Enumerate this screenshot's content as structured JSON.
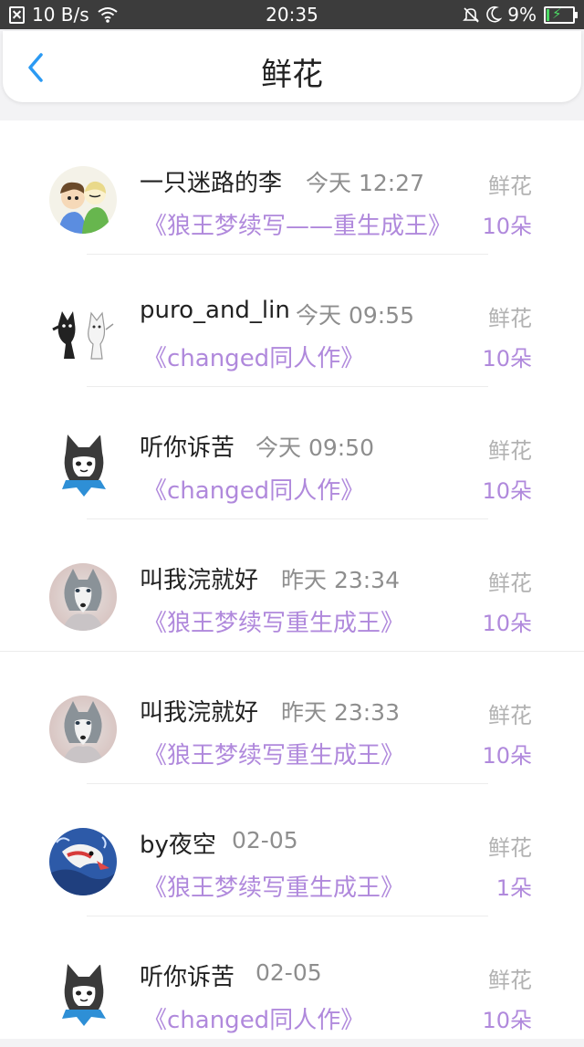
{
  "status_bar": {
    "net_speed": "10 B/s",
    "time": "20:35",
    "battery": "9%",
    "battery_level": 0.09,
    "icons": [
      "sim-icon",
      "wifi-icon",
      "mute-icon",
      "moon-icon",
      "battery-icon"
    ]
  },
  "nav": {
    "title": "鲜花",
    "back_icon": "chevron-left-icon"
  },
  "colors": {
    "accent": "#b089dc",
    "back": "#2b9af3",
    "gray": "#8e8e8e"
  },
  "items": [
    {
      "name": "一只迷路的李",
      "time": "今天 12:27",
      "work": "《狼王梦续写——重生成王》",
      "gift_label": "鲜花",
      "gift_count": "10朵",
      "avatar": "cartoon-kids-avatar"
    },
    {
      "name": "puro_and_lin",
      "time": "今天 09:55",
      "work": "《changed同人作》",
      "gift_label": "鲜花",
      "gift_count": "10朵",
      "avatar": "black-white-creatures-avatar"
    },
    {
      "name": "听你诉苦",
      "time": "今天 09:50",
      "work": "《changed同人作》",
      "gift_label": "鲜花",
      "gift_count": "10朵",
      "avatar": "wolf-cartoon-avatar"
    },
    {
      "name": "叫我浣就好",
      "time": "昨天 23:34",
      "work": "《狼王梦续写重生成王》",
      "gift_label": "鲜花",
      "gift_count": "10朵",
      "avatar": "wolf-photo-avatar"
    },
    {
      "name": "叫我浣就好",
      "time": "昨天 23:33",
      "work": "《狼王梦续写重生成王》",
      "gift_label": "鲜花",
      "gift_count": "10朵",
      "avatar": "wolf-photo-avatar"
    },
    {
      "name": "by夜空",
      "time": "02-05",
      "work": "《狼王梦续写重生成王》",
      "gift_label": "鲜花",
      "gift_count": "1朵",
      "avatar": "dragon-avatar"
    },
    {
      "name": "听你诉苦",
      "time": "02-05",
      "work": "《changed同人作》",
      "gift_label": "鲜花",
      "gift_count": "10朵",
      "avatar": "wolf-cartoon-avatar"
    }
  ]
}
